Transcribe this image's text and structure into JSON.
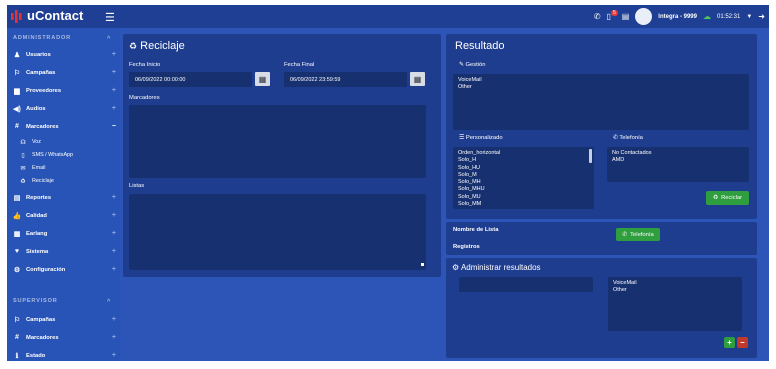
{
  "app": {
    "name": "uContact"
  },
  "topbar": {
    "notification_count": "5",
    "user_text": "Integra - 9999",
    "clock": "01:52:31"
  },
  "sidebar": {
    "admin_heading": "ADMINISTRADOR",
    "items": [
      {
        "label": "Usuarios",
        "icon": "user-icon"
      },
      {
        "label": "Campañas",
        "icon": "flag-icon"
      },
      {
        "label": "Proveedores",
        "icon": "truck-icon"
      },
      {
        "label": "Audios",
        "icon": "volume-icon"
      },
      {
        "label": "Marcadores",
        "icon": "hashtag-icon"
      }
    ],
    "sub_items": [
      {
        "label": "Voz",
        "icon": "headset-icon"
      },
      {
        "label": "SMS / WhatsApp",
        "icon": "mobile-icon"
      },
      {
        "label": "Email",
        "icon": "envelope-icon"
      },
      {
        "label": "Reciclaje",
        "icon": "recycle-icon"
      }
    ],
    "items2": [
      {
        "label": "Reportes",
        "icon": "file-icon"
      },
      {
        "label": "Calidad",
        "icon": "thumbs-up-icon"
      },
      {
        "label": "Earlang",
        "icon": "calculator-icon"
      },
      {
        "label": "Sistema",
        "icon": "heart-icon"
      },
      {
        "label": "Configuración",
        "icon": "cogs-icon"
      }
    ],
    "supervisor_heading": "SUPERVISOR",
    "supervisor_items": [
      {
        "label": "Campañas",
        "icon": "flag-icon"
      },
      {
        "label": "Marcadores",
        "icon": "hashtag-icon"
      },
      {
        "label": "Estado",
        "icon": "info-icon"
      }
    ]
  },
  "reciclaje": {
    "title": "Reciclaje",
    "fecha_inicio_label": "Fecha Inicio",
    "fecha_inicio_value": "06/09/2022 00:00:00",
    "fecha_final_label": "Fecha Final",
    "fecha_final_value": "06/09/2022 23:59:59",
    "marcadores_label": "Marcadores",
    "listas_label": "Listas"
  },
  "resultado": {
    "title": "Resultado",
    "gestion_label": "Gestión",
    "gestion_items": [
      "VoiceMail",
      "Other"
    ],
    "personalizado_label": "Personalizado",
    "personalizado_items": [
      "Orden_horizontal",
      "Solo_H",
      "Solo_HU",
      "Solo_M",
      "Solo_MH",
      "Solo_MHU",
      "Solo_MU",
      "Solo_MM"
    ],
    "telefonia_label": "Telefonía",
    "telefonia_items": [
      "No Contactados",
      "AMD"
    ],
    "reciclar_button": "Reciclar"
  },
  "info": {
    "nombre_lista_label": "Nombre de Lista",
    "registros_label": "Registros",
    "telefonia_button": "Telefonía"
  },
  "administrar": {
    "title": "Administrar resultados",
    "items": [
      "VoiceMail",
      "Other"
    ],
    "add_button": "+",
    "remove_button": "–"
  }
}
